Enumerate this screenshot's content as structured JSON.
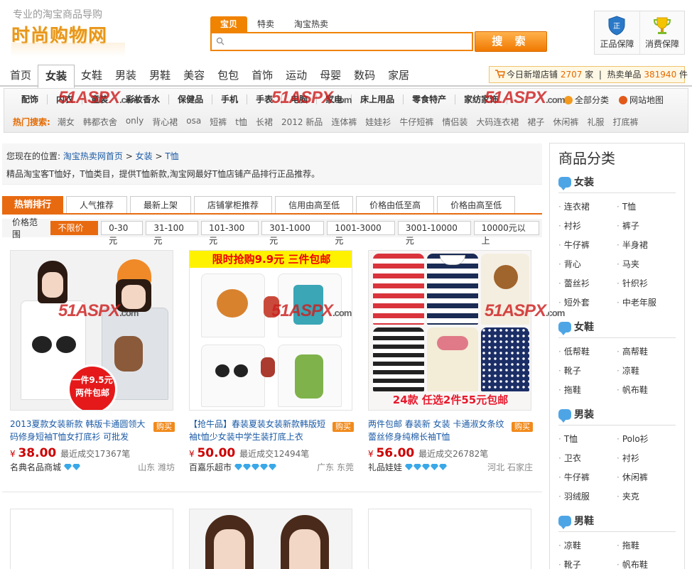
{
  "header": {
    "slogan": "专业的淘宝商品导购",
    "logo": "时尚购物网",
    "search_tabs": [
      "宝贝",
      "特卖",
      "淘宝热卖"
    ],
    "search_placeholder": "",
    "search_button": "搜 索",
    "badges": [
      {
        "label": "正品保障",
        "icon": "shield-icon"
      },
      {
        "label": "消费保障",
        "icon": "trophy-icon"
      }
    ]
  },
  "nav": {
    "items": [
      "首页",
      "女装",
      "女鞋",
      "男装",
      "男鞋",
      "美容",
      "包包",
      "首饰",
      "运动",
      "母婴",
      "数码",
      "家居"
    ],
    "active_index": 1,
    "stats": {
      "today_label": "今日新增店铺",
      "today_value": "2707",
      "today_unit": "家",
      "hot_label": "热卖单品",
      "hot_value": "381940",
      "hot_unit": "件"
    }
  },
  "categories": {
    "items": [
      "配饰",
      "内衣",
      "童装",
      "彩妆香水",
      "保健品",
      "手机",
      "手表",
      "电脑",
      "家电",
      "床上用品",
      "零食特产",
      "家纺家饰"
    ],
    "links": [
      {
        "label": "全部分类",
        "icon": "globe-icon"
      },
      {
        "label": "网站地图",
        "icon": "map-icon"
      }
    ],
    "hot_label": "热门搜索:",
    "hot_items": [
      "潮女",
      "韩都衣舍",
      "only",
      "背心裙",
      "osa",
      "短裤",
      "t恤",
      "长裙",
      "2012 新品",
      "连体裤",
      "娃娃衫",
      "牛仔短裤",
      "情侣装",
      "大码连衣裙",
      "裙子",
      "休闲裤",
      "礼服",
      "打底裤"
    ]
  },
  "watermark": {
    "brand": "51ASPX",
    "suffix": ".com"
  },
  "breadcrumb": {
    "prefix": "您现在的位置:",
    "path": [
      "淘宝热卖网首页",
      "女装",
      "T恤"
    ],
    "sep": ">",
    "description": "精品淘宝客T恤好，T恤类目，提供T恤新款,淘宝网最好T恤店铺产品排行正品推荐。"
  },
  "sort_tabs": [
    "热销排行",
    "人气推荐",
    "最新上架",
    "店铺掌柜推荐",
    "信用由高至低",
    "价格由低至高",
    "价格由高至低"
  ],
  "price_filter": {
    "label": "价格范围",
    "options": [
      "不限价格",
      "0-30元",
      "31-100元",
      "101-300元",
      "301-1000元",
      "1001-3000元",
      "3001-10000元",
      "10000元以上"
    ]
  },
  "products": [
    {
      "title": "2013夏款女装新款 韩版卡通圆领大码修身短袖T恤女打底衫 可批发",
      "currency": "¥",
      "price": "38.00",
      "sales": "最近成交17367笔",
      "shop": "名典名品商城",
      "diamonds": 2,
      "location": "山东 潍坊",
      "buy": "购买",
      "tag_line1": "一件9.5元",
      "tag_line2": "两件包邮"
    },
    {
      "title": "【抢牛品】春装夏装女装新款韩版短袖t恤少女装中学生装打底上衣",
      "currency": "¥",
      "price": "50.00",
      "sales": "最近成交12494笔",
      "shop": "百嘉乐超市",
      "diamonds": 5,
      "location": "广东 东莞",
      "buy": "购买",
      "banner": "限时抢购9.9元 三件包邮"
    },
    {
      "title": "两件包邮 春装新 女装 卡通淑女条纹蕾丝修身纯棉长袖T恤",
      "currency": "¥",
      "price": "56.00",
      "sales": "最近成交26782笔",
      "shop": "礼品娃娃",
      "diamonds": 5,
      "location": "河北 石家庄",
      "buy": "购买",
      "promo": "24款 任选2件55元包邮"
    }
  ],
  "sidebar": {
    "title": "商品分类",
    "groups": [
      {
        "name": "女装",
        "items": [
          "连衣裙",
          "T恤",
          "衬衫",
          "裤子",
          "牛仔裤",
          "半身裙",
          "背心",
          "马夹",
          "蕾丝衫",
          "针织衫",
          "短外套",
          "中老年服"
        ]
      },
      {
        "name": "女鞋",
        "items": [
          "低帮鞋",
          "高帮鞋",
          "靴子",
          "凉鞋",
          "拖鞋",
          "帆布鞋"
        ]
      },
      {
        "name": "男装",
        "items": [
          "T恤",
          "Polo衫",
          "卫衣",
          "衬衫",
          "牛仔裤",
          "休闲裤",
          "羽绒服",
          "夹克"
        ]
      },
      {
        "name": "男鞋",
        "items": [
          "凉鞋",
          "拖鞋",
          "靴子",
          "帆布鞋"
        ]
      }
    ]
  },
  "colors": {
    "accent": "#e86a10",
    "link": "#1a5aa6",
    "price": "#cc0000"
  }
}
